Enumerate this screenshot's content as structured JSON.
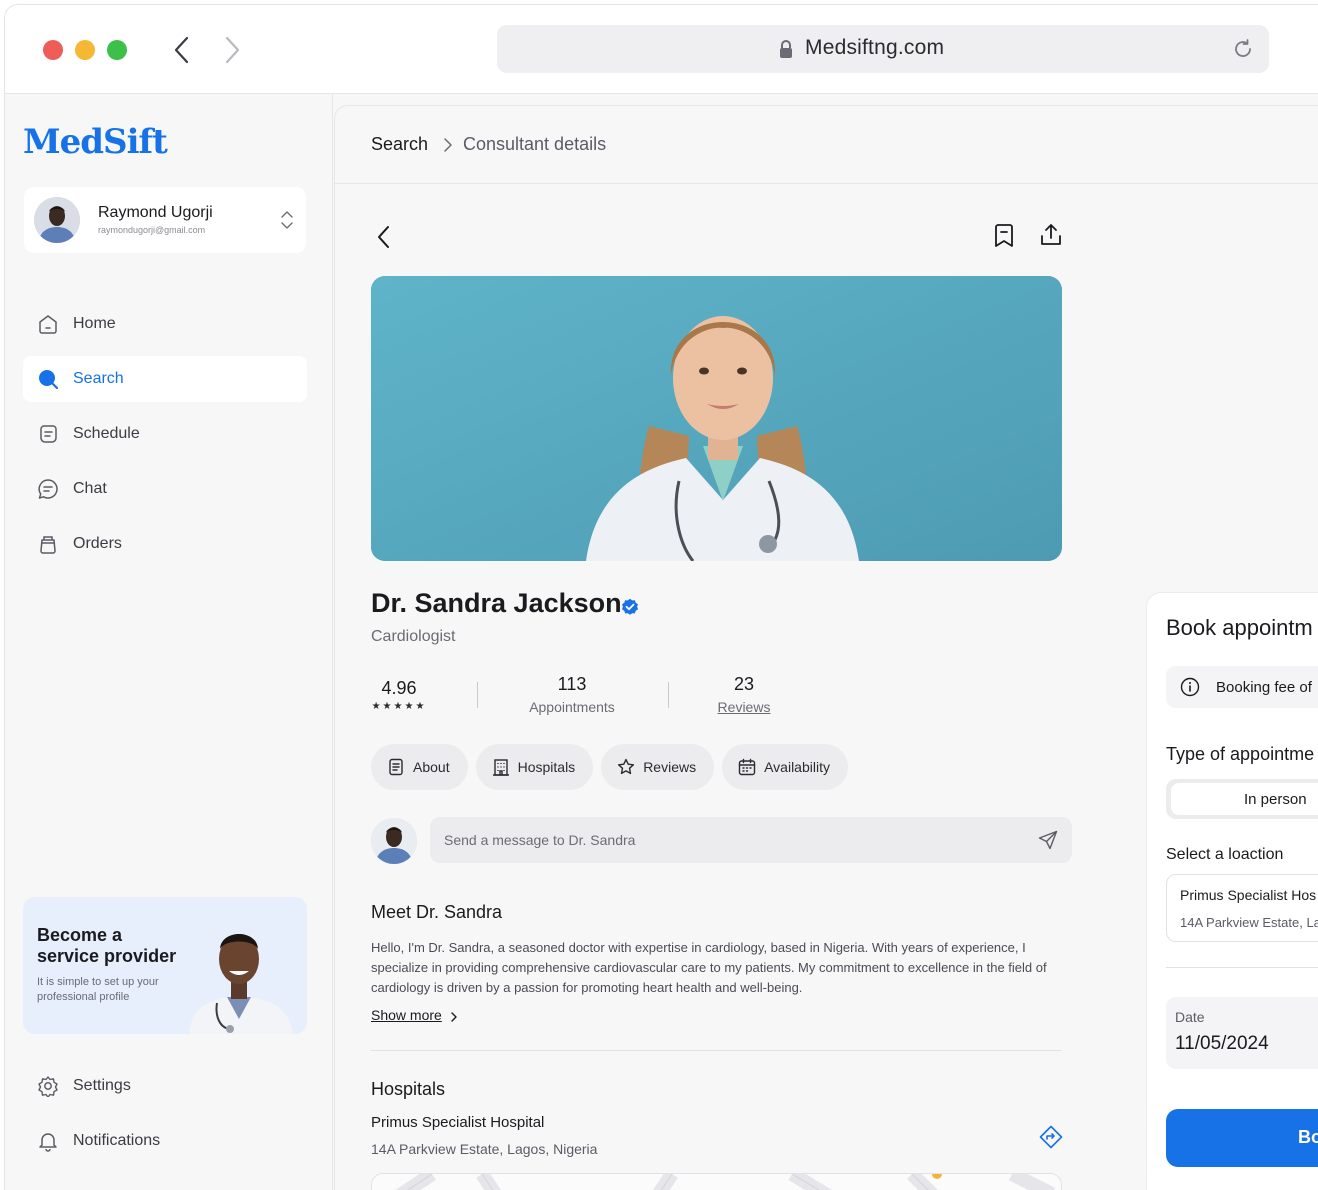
{
  "browser": {
    "url": "Medsiftng.com"
  },
  "sidebar": {
    "logo": "MedSift",
    "user": {
      "name": "Raymond Ugorji",
      "email": "raymondugorji@gmail.com"
    },
    "items": [
      {
        "label": "Home",
        "icon": "home-icon",
        "active": false
      },
      {
        "label": "Search",
        "icon": "search-icon",
        "active": true
      },
      {
        "label": "Schedule",
        "icon": "schedule-icon",
        "active": false
      },
      {
        "label": "Chat",
        "icon": "chat-icon",
        "active": false
      },
      {
        "label": "Orders",
        "icon": "orders-icon",
        "active": false
      }
    ],
    "promo": {
      "title": "Become a service provider",
      "subtitle": "It is simple to set up your professional profile"
    },
    "bottom_items": [
      {
        "label": "Settings",
        "icon": "settings-icon"
      },
      {
        "label": "Notifications",
        "icon": "bell-icon"
      }
    ]
  },
  "breadcrumb": {
    "root": "Search",
    "current": "Consultant details"
  },
  "doctor": {
    "name": "Dr. Sandra Jackson",
    "specialty": "Cardiologist",
    "rating": "4.96",
    "stars": "★★★★★",
    "appointments_value": "113",
    "appointments_label": "Appointments",
    "reviews_value": "23",
    "reviews_label": "Reviews"
  },
  "tabs": [
    {
      "label": "About",
      "icon": "document-icon"
    },
    {
      "label": "Hospitals",
      "icon": "building-icon"
    },
    {
      "label": "Reviews",
      "icon": "star-icon"
    },
    {
      "label": "Availability",
      "icon": "calendar-icon"
    }
  ],
  "message": {
    "placeholder": "Send a message to Dr. Sandra"
  },
  "about": {
    "title": "Meet Dr. Sandra",
    "text": "Hello, I'm Dr. Sandra, a seasoned doctor with expertise in cardiology, based in Nigeria. With years of experience, I specialize in providing comprehensive cardiovascular care to my patients. My commitment to excellence in the field of cardiology is driven by a passion for promoting heart health and well-being.",
    "show_more": "Show more"
  },
  "hospitals": {
    "title": "Hospitals",
    "name": "Primus Specialist Hospital",
    "address": "14A Parkview Estate, Lagos, Nigeria"
  },
  "booking": {
    "title": "Book appointm",
    "info": "Booking fee of",
    "type_title": "Type of appointme",
    "type_selected": "In person",
    "location_label": "Select a loaction",
    "location_name": "Primus Specialist Hos",
    "location_address": "14A Parkview Estate, La",
    "date_label": "Date",
    "date_value": "11/05/2024",
    "button": "Boo"
  },
  "colors": {
    "accent": "#1672e6",
    "background": "#f7f7f8",
    "promo_bg": "#e7eefc"
  }
}
